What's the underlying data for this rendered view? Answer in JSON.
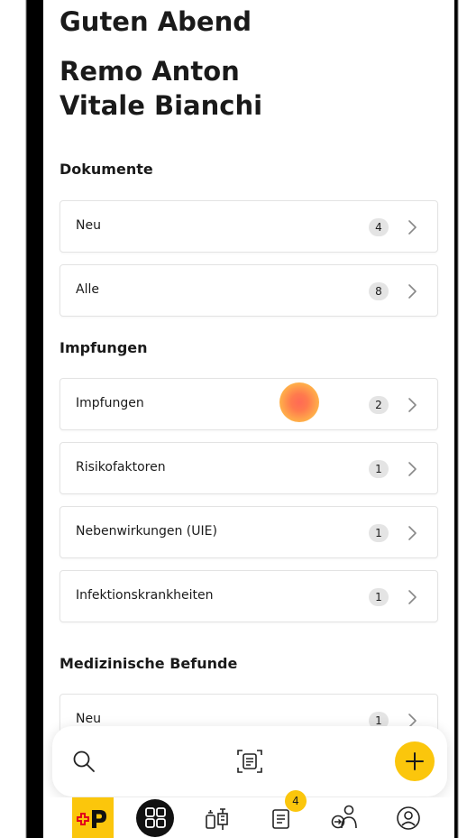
{
  "header": {
    "greeting": "Guten Abend",
    "name_line1": "Remo Anton",
    "name_line2": "Vitale Bianchi"
  },
  "sections": [
    {
      "title": "Dokumente",
      "items": [
        {
          "label": "Neu",
          "count": "4"
        },
        {
          "label": "Alle",
          "count": "8"
        }
      ]
    },
    {
      "title": "Impfungen",
      "items": [
        {
          "label": "Impfungen",
          "count": "2"
        },
        {
          "label": "Risikofaktoren",
          "count": "1"
        },
        {
          "label": "Nebenwirkungen (UIE)",
          "count": "1"
        },
        {
          "label": "Infektionskrankheiten",
          "count": "1"
        }
      ]
    },
    {
      "title": "Medizinische Befunde",
      "items": [
        {
          "label": "Neu",
          "count": "1"
        }
      ]
    }
  ],
  "tabbar": {
    "documents_badge": "4",
    "icons": [
      "swiss-post-logo-icon",
      "dashboard-icon",
      "vaccination-icon",
      "documents-icon",
      "sharing-icon",
      "profile-icon"
    ]
  },
  "colors": {
    "accent_yellow": "#fbc60c",
    "badge_gray": "#e4e4e4",
    "post_red": "#e2001a"
  }
}
